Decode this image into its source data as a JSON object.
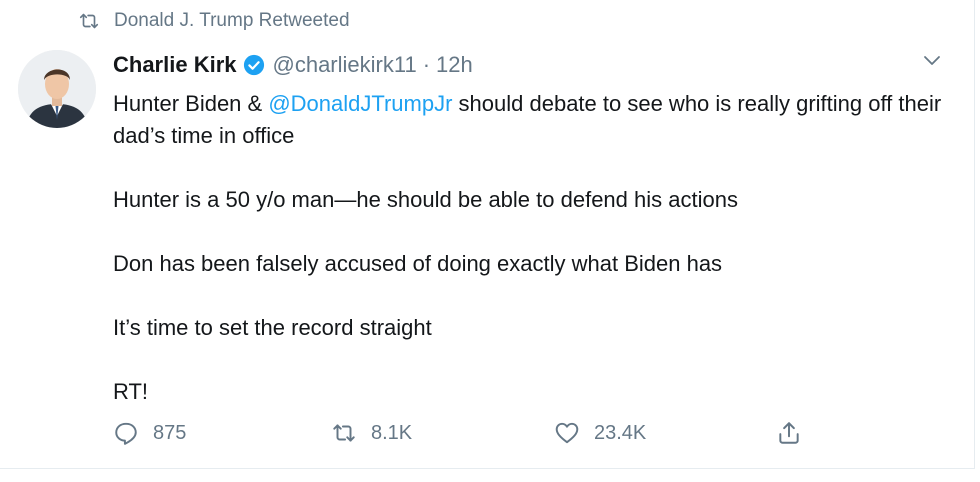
{
  "retweet_context": {
    "label": "Donald J. Trump Retweeted"
  },
  "author": {
    "name": "Charlie Kirk",
    "handle": "@charliekirk11",
    "separator": "·",
    "time": "12h"
  },
  "tweet": {
    "line1_before": "Hunter Biden & ",
    "mention": "@DonaldJTrumpJr",
    "line1_after": " should debate to see who is really grifting off their dad’s time in office",
    "para2": "Hunter is a 50 y/o man—he should be able to defend his actions",
    "para3": "Don has been falsely accused of doing exactly what Biden has",
    "para4": "It’s time to set the record straight",
    "para5": "RT!"
  },
  "actions": {
    "replies": "875",
    "retweets": "8.1K",
    "likes": "23.4K"
  },
  "colors": {
    "accent": "#1da1f2",
    "muted": "#657786",
    "text": "#14171a"
  },
  "icons": [
    "retweet-icon",
    "verified-badge-icon",
    "chevron-down-icon",
    "reply-icon",
    "like-icon",
    "share-icon"
  ]
}
